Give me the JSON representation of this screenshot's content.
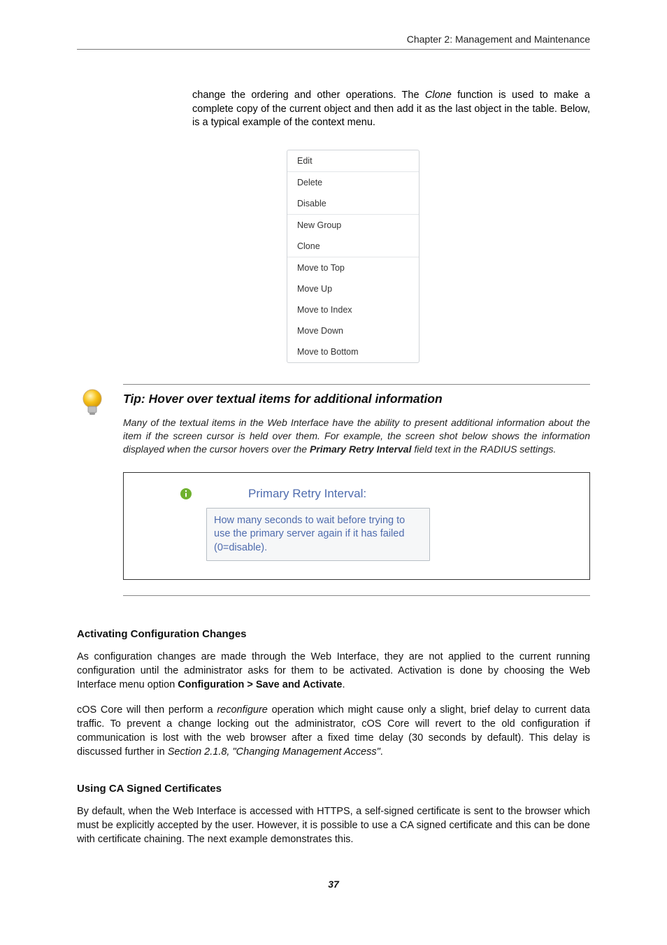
{
  "runhead": "Chapter 2: Management and Maintenance",
  "intro_before": "change the ordering and other operations. The ",
  "intro_clone": "Clone",
  "intro_after": " function is used to make a complete copy of the current object and then add it as the last object in the table. Below, is a typical example of the context menu.",
  "menu": {
    "edit": "Edit",
    "delete": "Delete",
    "disable": "Disable",
    "newgroup": "New Group",
    "clone": "Clone",
    "mtop": "Move to Top",
    "mup": "Move Up",
    "mindex": "Move to Index",
    "mdown": "Move Down",
    "mbottom": "Move to Bottom"
  },
  "tip": {
    "title": "Tip: Hover over textual items for additional information",
    "para_before": "Many of the textual items in the Web Interface have the ability to present additional information about the item if the screen cursor is held over them. For example, the screen shot below shows the information displayed when the cursor hovers over the ",
    "para_bold": "Primary Retry Interval",
    "para_after": " field text in the RADIUS settings."
  },
  "tooltip": {
    "label": "Primary Retry Interval:",
    "text": "How many seconds to wait before trying to use the primary server again if it has failed (0=disable)."
  },
  "sect1": {
    "h": "Activating Configuration Changes",
    "p1_before": "As configuration changes are made through the Web Interface, they are not applied to the current running configuration until the administrator asks for them to be activated. Activation is done by choosing the Web Interface menu option ",
    "p1_b1": "Configuration > Save and Activate",
    "p1_after": ".",
    "p2_a": "cOS Core will then perform a ",
    "p2_em": "reconfigure",
    "p2_b": " operation which might cause only a slight, brief delay to current data traffic. To prevent a change locking out the administrator, cOS Core will revert to the old configuration if communication is lost with the web browser after a fixed time delay (30 seconds by default). This delay is discussed further in ",
    "p2_ref": "Section 2.1.8, \"Changing Management Access\"",
    "p2_c": "."
  },
  "sect2": {
    "h": "Using CA Signed Certificates",
    "p": "By default, when the Web Interface is accessed with HTTPS, a self-signed certificate is sent to the browser which must be explicitly accepted by the user. However, it is possible to use a CA signed certificate and this can be done with certificate chaining. The next example demonstrates this."
  },
  "pagenum": "37"
}
